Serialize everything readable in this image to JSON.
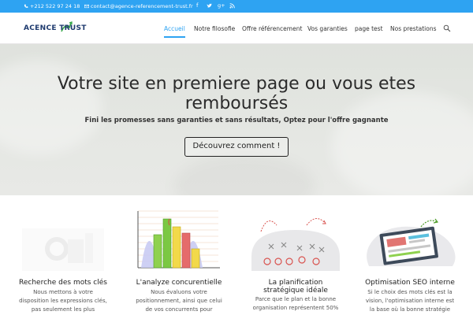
{
  "topbar": {
    "phone": "+212 522 97 24 18",
    "email": "contact@agence-referencement-trust.fr",
    "social_icons": [
      "facebook-icon",
      "twitter-icon",
      "google-plus-icon",
      "rss-icon"
    ],
    "bg_color": "#2ea3f2"
  },
  "header": {
    "logo_text": "ACENCE TRUST",
    "nav": [
      {
        "label": "Accueil",
        "active": true
      },
      {
        "label": "Notre filosofie",
        "active": false
      },
      {
        "label": "Offre référencement",
        "active": false
      },
      {
        "label": "Vos garanties",
        "active": false
      },
      {
        "label": "page test",
        "active": false
      },
      {
        "label": "Nos prestations",
        "active": false
      }
    ],
    "accent_color": "#2ea3f2"
  },
  "hero": {
    "title_line1": "Votre site en premiere page ou vous etes",
    "title_line2": "remboursés",
    "subtitle": "Fini les promesses sans garanties et sans résultats, Optez pour l'offre gagnante",
    "button_label": "Découvrez comment !"
  },
  "features": [
    {
      "icon": "magnifier-illustration",
      "title": "Recherche des mots clés",
      "body_lines": [
        "Nous mettons à votre",
        "disposition les expressions clés,",
        "pas seulement les plus"
      ]
    },
    {
      "icon": "bar-chart-illustration",
      "title": "L'analyze concurentielle",
      "body_lines": [
        "Nous évaluons votre",
        "positionnement, ainsi que celui",
        "de vos concurrents pour"
      ]
    },
    {
      "icon": "strategy-board-illustration",
      "title_lines": [
        "La planification",
        "stratégique idéale"
      ],
      "body_lines": [
        "Parce que le plan et la bonne",
        "organisation représentent 50%"
      ]
    },
    {
      "icon": "laptop-seo-illustration",
      "title": "Optimisation SEO interne",
      "body_lines": [
        "Si le choix des mots clés est la",
        "vision, l'optimisation interne est",
        "la base où la bonne stratégie"
      ]
    }
  ]
}
